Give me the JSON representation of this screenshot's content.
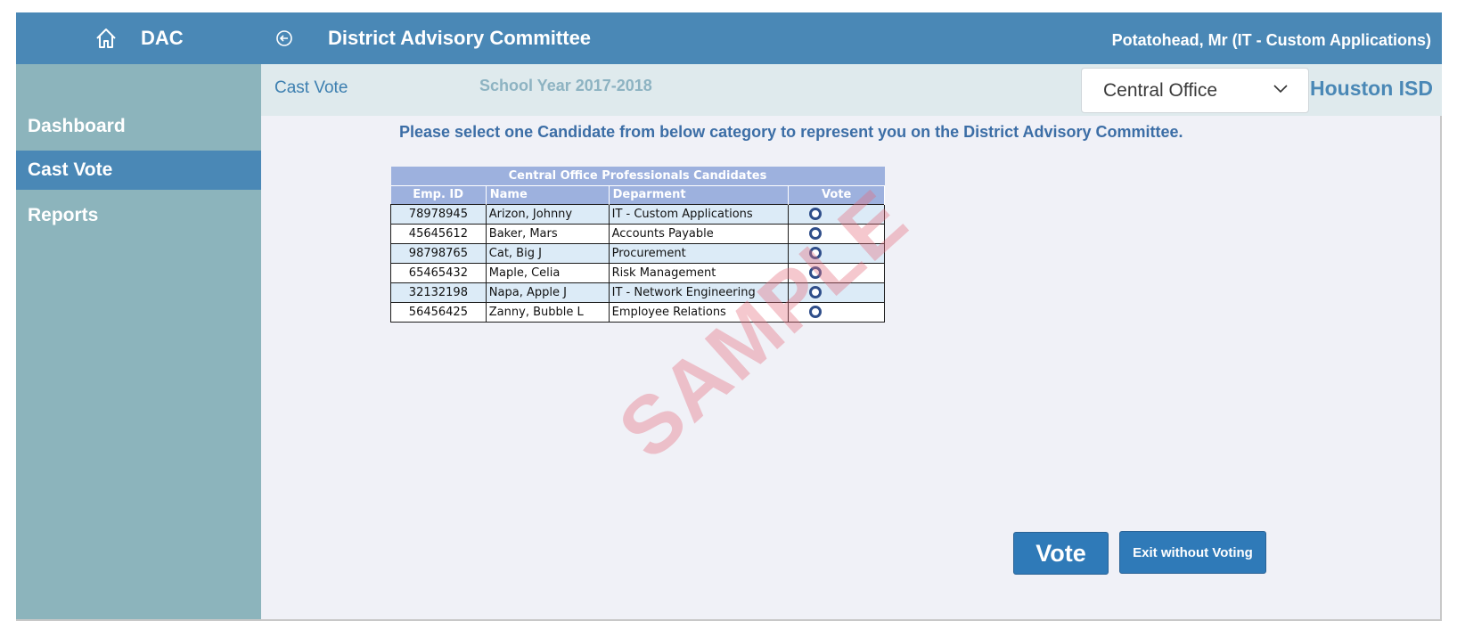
{
  "header": {
    "app_name": "DAC",
    "title": "District Advisory Committee",
    "user": "Potatohead, Mr (IT - Custom Applications)"
  },
  "sidebar": {
    "items": [
      {
        "label": "Dashboard",
        "active": false
      },
      {
        "label": "Cast Vote",
        "active": true
      },
      {
        "label": "Reports",
        "active": false
      }
    ]
  },
  "subheader": {
    "page": "Cast Vote",
    "school_year": "School Year  2017-2018",
    "dropdown_value": "Central Office",
    "district": "Houston ISD"
  },
  "main": {
    "instruction": "Please select one Candidate from below category to represent you on the District Advisory Committee.",
    "table": {
      "title": "Central Office Professionals Candidates",
      "columns": [
        "Emp. ID",
        "Name",
        "Deparment",
        "Vote"
      ],
      "rows": [
        {
          "id": "78978945",
          "name": "Arizon, Johnny",
          "dept": "IT - Custom Applications"
        },
        {
          "id": "45645612",
          "name": "Baker,  Mars",
          "dept": "Accounts Payable"
        },
        {
          "id": "98798765",
          "name": "Cat,  Big J",
          "dept": "Procurement"
        },
        {
          "id": "65465432",
          "name": "Maple,  Celia",
          "dept": "Risk Management"
        },
        {
          "id": "32132198",
          "name": "Napa, Apple J",
          "dept": "IT - Network Engineering"
        },
        {
          "id": "56456425",
          "name": "Zanny, Bubble L",
          "dept": "Employee Relations"
        }
      ]
    },
    "watermark": "SAMPLE",
    "vote_button": "Vote",
    "exit_button": "Exit without Voting"
  },
  "colors": {
    "header_bg": "#4a88b6",
    "sidebar_bg": "#8cb4bc",
    "table_header": "#9db1de",
    "watermark": "#e66e7d"
  }
}
